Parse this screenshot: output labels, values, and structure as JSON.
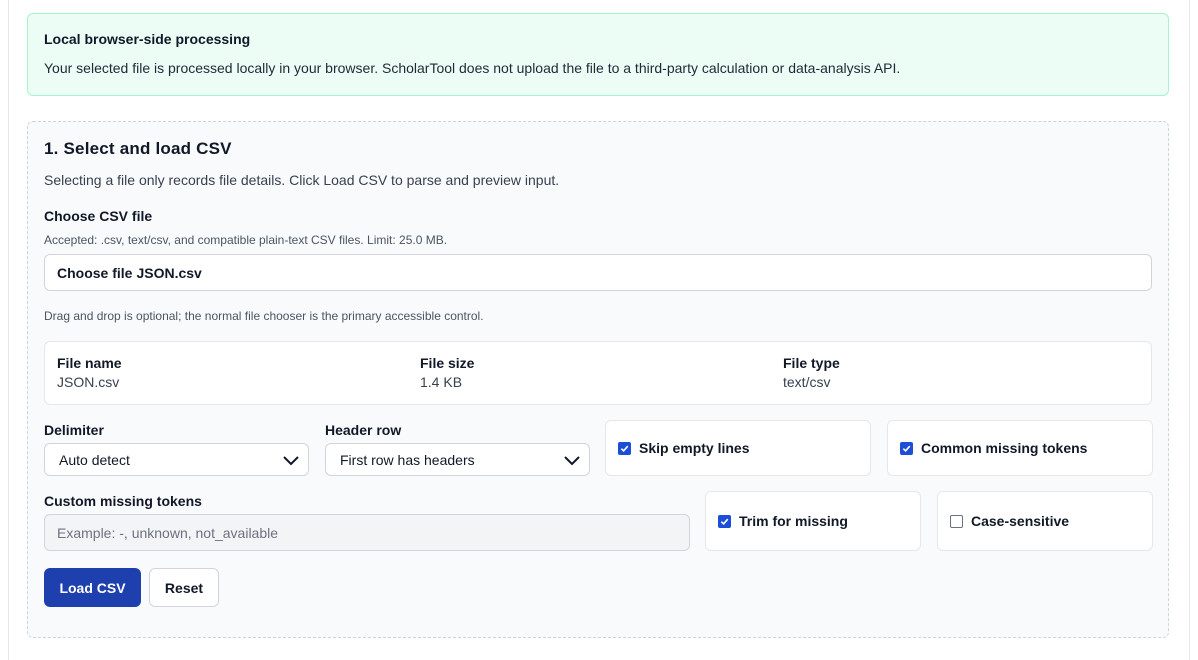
{
  "notice": {
    "title": "Local browser-side processing",
    "text": "Your selected file is processed locally in your browser. ScholarTool does not upload the file to a third-party calculation or data-analysis API."
  },
  "section": {
    "title": "1. Select and load CSV",
    "subtitle": "Selecting a file only records file details. Click Load CSV to parse and preview input."
  },
  "file_chooser": {
    "label": "Choose CSV file",
    "accepted_hint": "Accepted: .csv, text/csv, and compatible plain-text CSV files. Limit: 25.0 MB.",
    "button_label": "Choose file",
    "file_name": "JSON.csv",
    "dnd_hint": "Drag and drop is optional; the normal file chooser is the primary accessible control."
  },
  "file_details": {
    "name_label": "File name",
    "name_value": "JSON.csv",
    "size_label": "File size",
    "size_value": "1.4 KB",
    "type_label": "File type",
    "type_value": "text/csv"
  },
  "delimiter": {
    "label": "Delimiter",
    "selected": "Auto detect"
  },
  "header_row": {
    "label": "Header row",
    "selected": "First row has headers"
  },
  "options": {
    "skip_empty_lines": {
      "label": "Skip empty lines",
      "checked": true
    },
    "common_missing_tokens": {
      "label": "Common missing tokens",
      "checked": true
    },
    "trim_for_missing": {
      "label": "Trim for missing",
      "checked": true
    },
    "case_sensitive": {
      "label": "Case-sensitive",
      "checked": false
    }
  },
  "custom_missing": {
    "label": "Custom missing tokens",
    "placeholder": "Example: -, unknown, not_available",
    "value": ""
  },
  "actions": {
    "load_label": "Load CSV",
    "reset_label": "Reset"
  },
  "colors": {
    "accent": "#1e40af",
    "checkbox": "#1d4ed8",
    "notice_bg": "#ecfdf5",
    "notice_border": "#a7f3d0"
  }
}
